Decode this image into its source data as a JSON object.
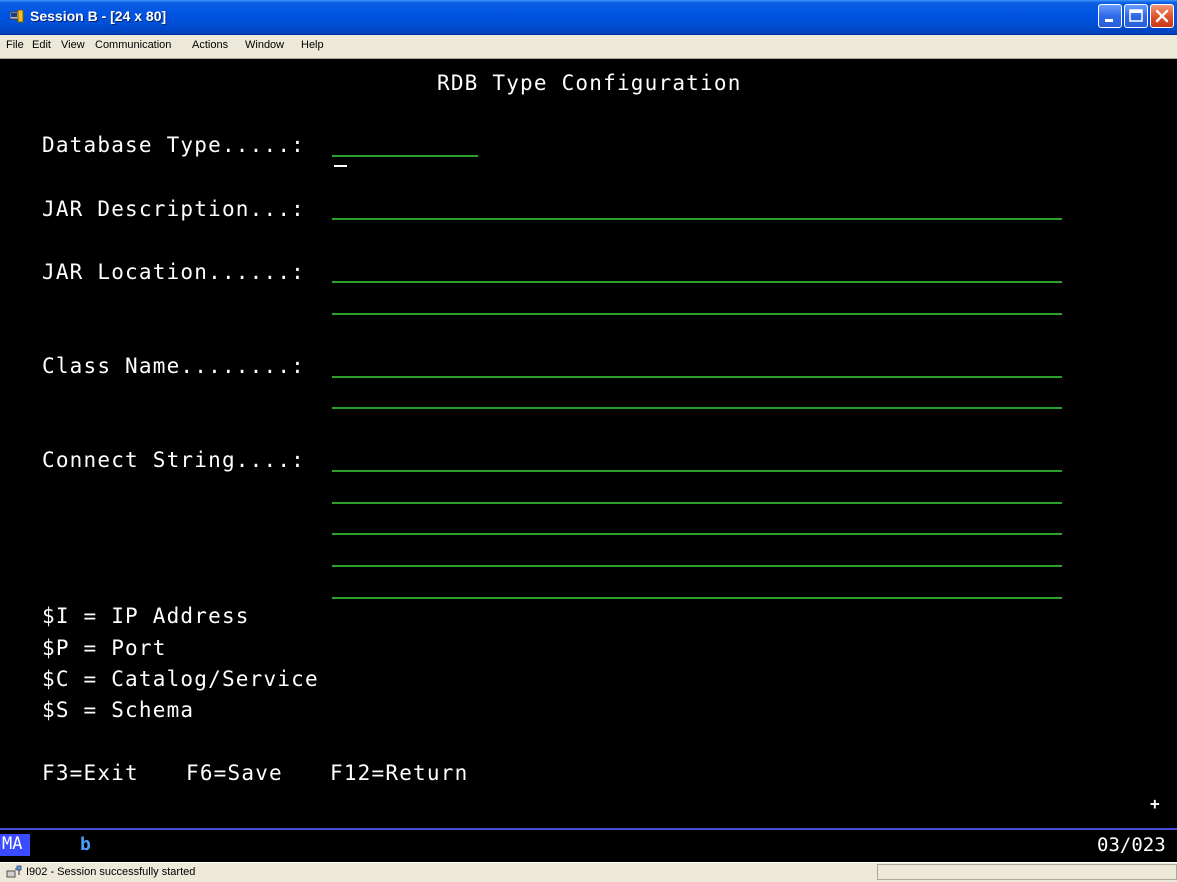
{
  "window": {
    "title": "Session B - [24 x 80]",
    "icons": [
      "session-icon",
      "minimize-icon",
      "maximize-icon",
      "close-icon"
    ]
  },
  "menu": {
    "items": [
      "File",
      "Edit",
      "View",
      "Communication",
      "Actions",
      "Window",
      "Help"
    ]
  },
  "screen": {
    "title": "RDB Type Configuration",
    "fields": {
      "database_type": {
        "label": "Database Type.....:",
        "value": ""
      },
      "jar_description": {
        "label": "JAR Description...:",
        "value": ""
      },
      "jar_location": {
        "label": "JAR Location......:",
        "value": ""
      },
      "class_name": {
        "label": "Class Name........:",
        "value": ""
      },
      "connect_string": {
        "label": "Connect String....:",
        "value": ""
      }
    },
    "legend": [
      "$I = IP Address",
      "$P = Port",
      "$C = Catalog/Service",
      "$S = Schema"
    ],
    "function_keys": [
      "F3=Exit",
      "F6=Save",
      "F12=Return"
    ],
    "plus_marker": "+"
  },
  "oia": {
    "mode": "MA",
    "indicator": "b",
    "cursor_position": "03/023"
  },
  "status": {
    "message": "I902 - Session successfully started"
  },
  "colors": {
    "terminal_bg": "#000000",
    "text": "#ffffff",
    "input_field": "#2aa02a",
    "oia_highlight": "#3b4bff",
    "titlebar": "#0054e3"
  }
}
